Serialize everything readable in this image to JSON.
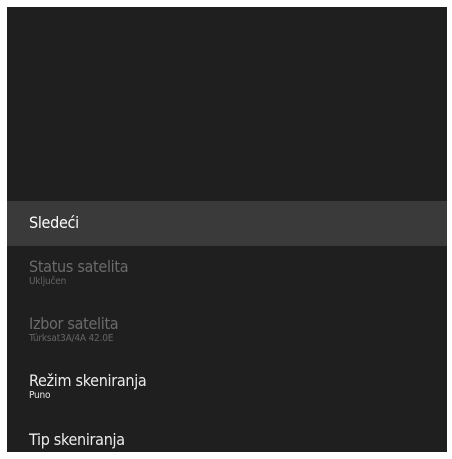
{
  "menu": {
    "items": [
      {
        "label": "Sledeći",
        "state": "focused"
      },
      {
        "label": "Status satelita",
        "value": "Uključen",
        "state": "disabled"
      },
      {
        "label": "Izbor satelita",
        "value": "Türksat3A/4A 42.0E",
        "state": "disabled"
      },
      {
        "label": "Režim skeniranja",
        "value": "Puno",
        "state": "enabled"
      },
      {
        "label": "Tip skeniranja",
        "state": "enabled"
      }
    ]
  },
  "colors": {
    "background": "#1f1f1f",
    "focus_highlight": "#3a3a3a",
    "text_enabled": "#ededed",
    "text_disabled": "#6b6b6b"
  }
}
